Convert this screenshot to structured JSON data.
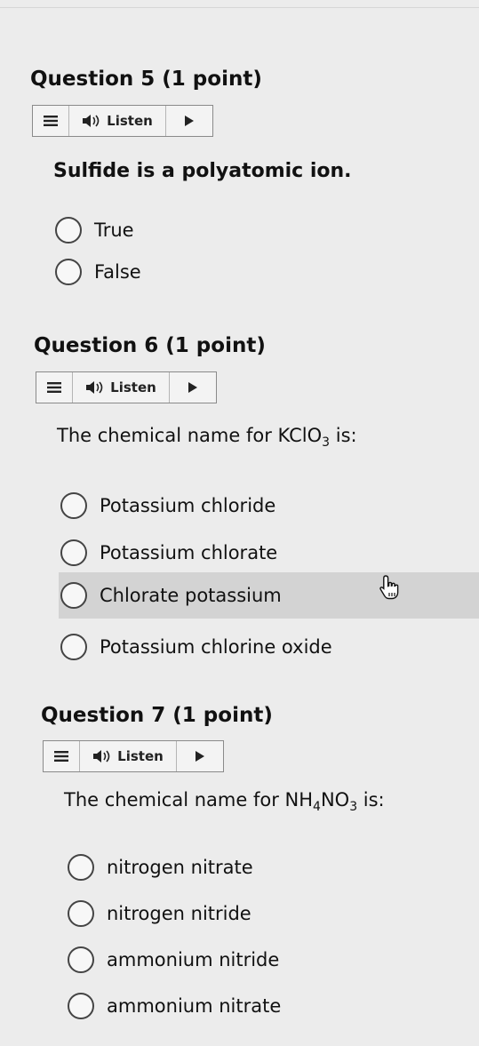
{
  "questions": [
    {
      "title": "Question 5 (1 point)",
      "listen_label": "Listen",
      "prompt": "Sulfide is a polyatomic ion.",
      "options": [
        "True",
        "False"
      ]
    },
    {
      "title": "Question 6 (1 point)",
      "listen_label": "Listen",
      "prompt": {
        "before": "The chemical name for ",
        "formula": [
          "KClO",
          "3"
        ],
        "after": " is:"
      },
      "options": [
        "Potassium chloride",
        "Potassium chlorate",
        "Chlorate potassium",
        "Potassium chlorine oxide"
      ],
      "hovered_option": "Chlorate potassium"
    },
    {
      "title": "Question 7 (1 point)",
      "listen_label": "Listen",
      "prompt": {
        "before": "The chemical name for ",
        "formula": [
          "NH",
          "4",
          "NO",
          "3"
        ],
        "after": " is:"
      },
      "options": [
        "nitrogen nitrate",
        "nitrogen nitride",
        "ammonium nitride",
        "ammonium nitrate"
      ]
    }
  ],
  "icons": {
    "menu": "hamburger-menu-icon",
    "audio": "speaker-icon",
    "play": "play-icon",
    "cursor": "hand-pointer-icon"
  }
}
